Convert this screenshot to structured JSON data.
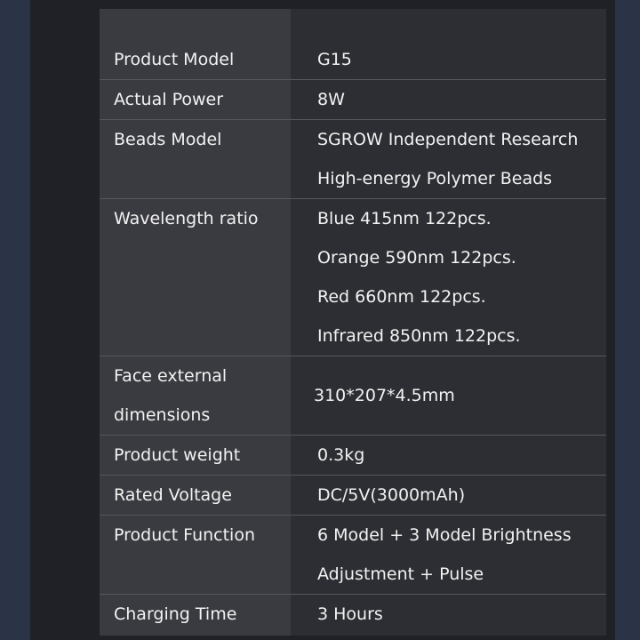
{
  "specs": [
    {
      "label": [
        "Product Model"
      ],
      "value": [
        "G15"
      ]
    },
    {
      "label": [
        "Actual Power"
      ],
      "value": [
        "8W"
      ]
    },
    {
      "label": [
        "Beads Model"
      ],
      "value": [
        "SGROW Independent  Research",
        "High-energy Polymer Beads"
      ]
    },
    {
      "label": [
        "Wavelength ratio"
      ],
      "value": [
        "Blue 415nm 122pcs.",
        "Orange 590nm 122pcs.",
        "Red 660nm 122pcs.",
        "Infrared 850nm 122pcs."
      ]
    },
    {
      "label": [
        "Face external",
        "dimensions"
      ],
      "value": [
        "310*207*4.5mm"
      ]
    },
    {
      "label": [
        "Product weight"
      ],
      "value": [
        "0.3kg"
      ]
    },
    {
      "label": [
        "Rated Voltage"
      ],
      "value": [
        "DC/5V(3000mAh)"
      ]
    },
    {
      "label": [
        "Product Function"
      ],
      "value": [
        "6 Model + 3 Model Brightness",
        "Adjustment + Pulse"
      ]
    },
    {
      "label": [
        "Charging Time"
      ],
      "value": [
        "3 Hours"
      ]
    }
  ]
}
